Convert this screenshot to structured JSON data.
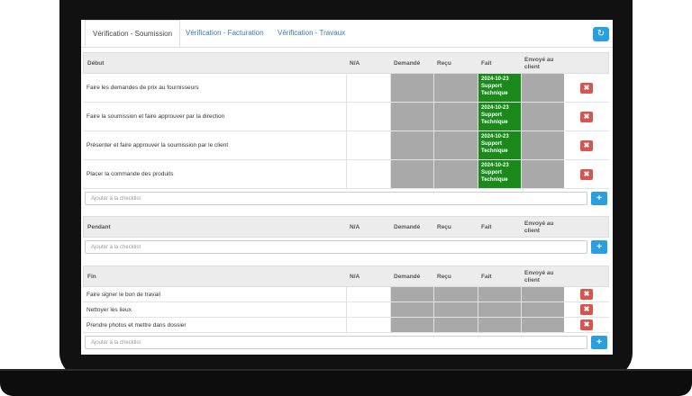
{
  "tabs": [
    "Vérification - Soumission",
    "Vérification - Facturation",
    "Vérification - Travaux"
  ],
  "refresh_icon": "refresh-icon",
  "columns": {
    "na": "N/A",
    "demande": "Demandé",
    "recu": "Reçu",
    "fait": "Fait",
    "envoye": "Envoyé au client"
  },
  "sections": {
    "debut": {
      "title": "Début",
      "items": [
        {
          "label": "Faire les demandes de prix au fournisseurs",
          "fait_date": "2024-10-23",
          "fait_by": "Support Technique"
        },
        {
          "label": "Faire la soumission et faire approuver par la direction",
          "fait_date": "2024-10-23",
          "fait_by": "Support Technique"
        },
        {
          "label": "Présenter et faire approuver la soumission par le client",
          "fait_date": "2024-10-23",
          "fait_by": "Support Technique"
        },
        {
          "label": "Placer la commande des produits",
          "fait_date": "2024-10-23",
          "fait_by": "Support Technique"
        }
      ],
      "add_placeholder": "Ajouter à la checklist"
    },
    "pendant": {
      "title": "Pendant",
      "items": [],
      "add_placeholder": "Ajouter à la checklist"
    },
    "fin": {
      "title": "Fin",
      "items": [
        {
          "label": "Faire signer le bon de travail"
        },
        {
          "label": "Nettoyer les lieux"
        },
        {
          "label": "Prendre photos et mettre dans dossier"
        }
      ],
      "add_placeholder": "Ajouter à la checklist"
    }
  },
  "colors": {
    "accent": "#2a9fe0",
    "done": "#1a8a1a",
    "danger": "#d9534f",
    "pending": "#a9a9a9"
  }
}
